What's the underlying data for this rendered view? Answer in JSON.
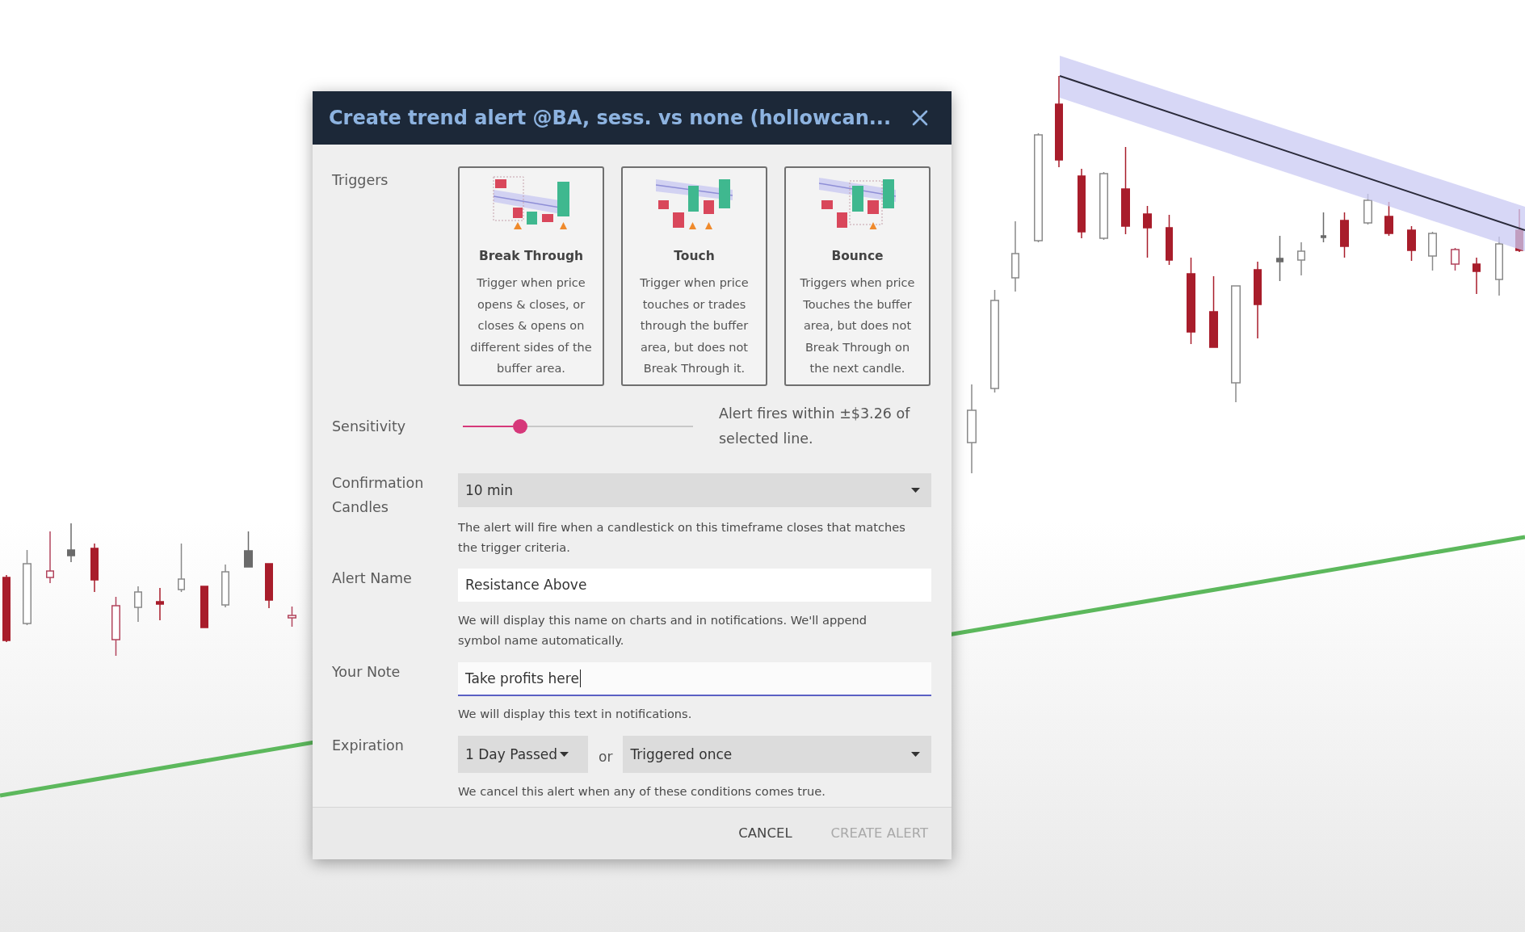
{
  "dialog": {
    "title": "Create trend alert @BA, sess. vs none (hollowcan...",
    "triggers": {
      "label": "Triggers",
      "options": [
        {
          "kind": "break_through",
          "name": "Break Through",
          "description": "Trigger when price\nopens & closes, or\ncloses & opens on\ndifferent sides of the\nbuffer area.",
          "selected": false
        },
        {
          "kind": "touch",
          "name": "Touch",
          "description": "Trigger when price\ntouches or trades\nthrough the buffer\narea, but does not\nBreak Through it.",
          "selected": false
        },
        {
          "kind": "bounce",
          "name": "Bounce",
          "description": "Triggers when price\nTouches the buffer\narea, but does not\nBreak Through on\nthe next candle.",
          "selected": false
        }
      ]
    },
    "sensitivity": {
      "label": "Sensitivity",
      "level": 0.25,
      "reading": "Alert fires within ±$3.26 of\nselected line."
    },
    "confirmation_candles": {
      "label": "Confirmation Candles",
      "value": "10 min",
      "help": "The alert will fire when a candlestick on this timeframe closes that matches\nthe trigger criteria."
    },
    "alert_name": {
      "label": "Alert Name",
      "value": "Resistance Above",
      "help": "We will display this name on charts and in notifications. We'll append\nsymbol name automatically."
    },
    "note": {
      "label": "Your Note",
      "value": "Take profits here",
      "focused": true,
      "help": "We will display this text in notifications."
    },
    "expiration": {
      "label": "Expiration",
      "period": "1 Day Passed",
      "separator": "or",
      "condition": "Triggered once",
      "help": "We cancel this alert when any of these conditions comes true."
    },
    "buttons": [
      {
        "label": "CANCEL",
        "disabled": false
      },
      {
        "label": "CREATE ALERT",
        "disabled": true
      }
    ]
  }
}
